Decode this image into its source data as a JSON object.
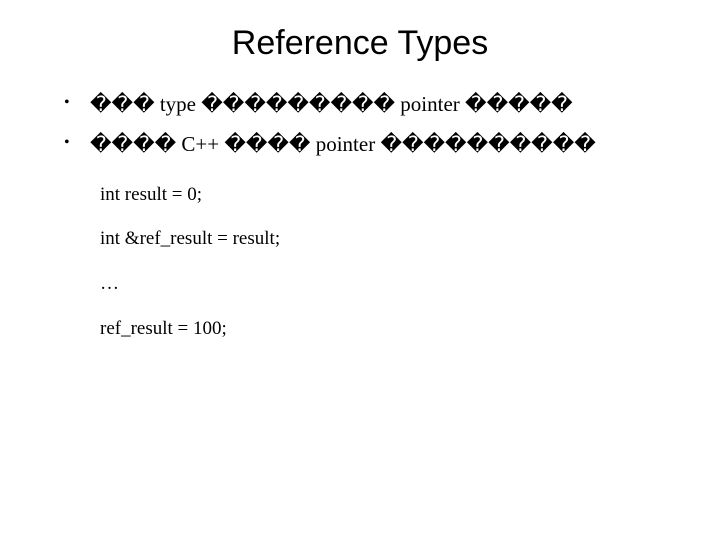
{
  "title": "Reference Types",
  "bullets": [
    "��� type ��������� pointer �����",
    "���� C++ ���� pointer ����������"
  ],
  "code_lines": [
    "int result = 0;",
    "int &ref_result = result;",
    "…",
    "ref_result = 100;"
  ]
}
